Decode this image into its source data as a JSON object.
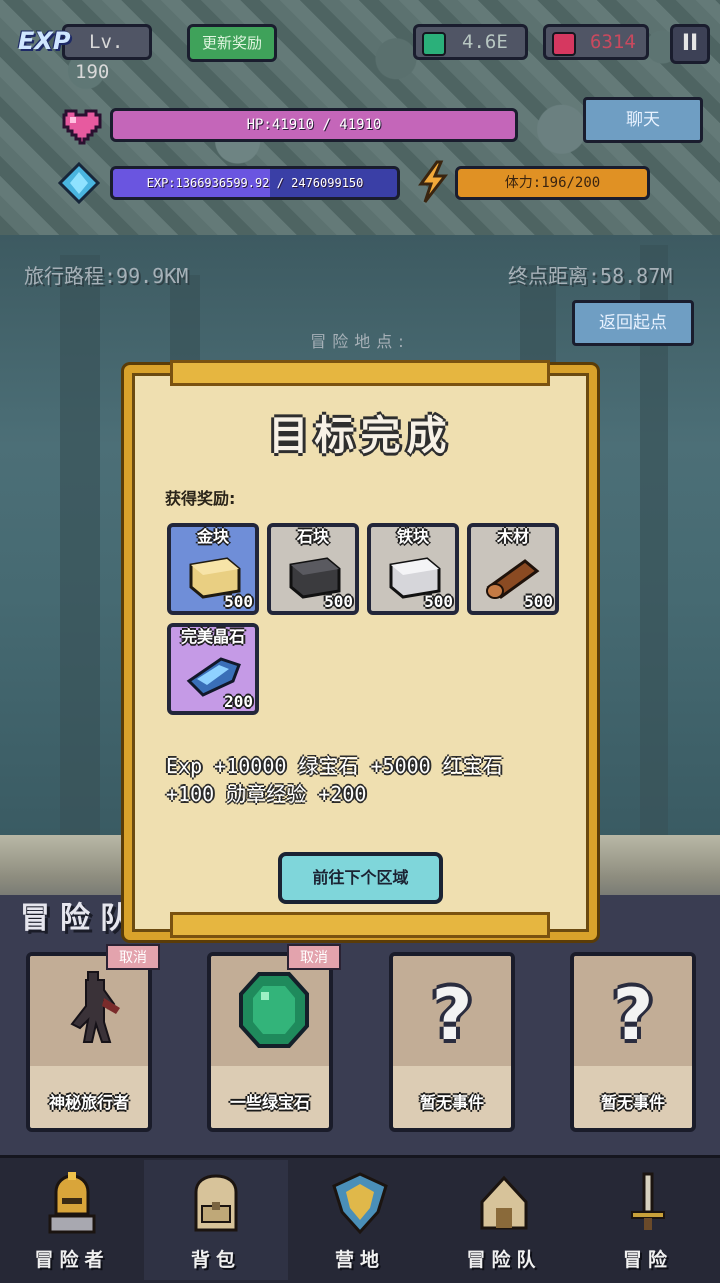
{
  "hud": {
    "exp_badge": "EXP",
    "level": "Lv. 190",
    "update_reward_label": "更新奖励",
    "emerald_count": "4.6E",
    "ruby_count": "6314",
    "pause_label": "II",
    "hp_text": "HP:41910 / 41910",
    "exp_text": "EXP:1366936599.92 / 2476099150",
    "exp_progress": 0.552,
    "stamina_text": "体力:196/200",
    "stamina_progress": 0.98,
    "chat_label": "聊天"
  },
  "journey": {
    "travel_distance": "旅行路程:99.9KM",
    "end_distance": "终点距离:58.87M",
    "return_label": "返回起点",
    "location_label": "冒险地点:"
  },
  "modal": {
    "title": "目标完成",
    "rewards_heading": "获得奖励:",
    "items": [
      {
        "name": "金块",
        "qty": "500",
        "icon": "gold-block-icon"
      },
      {
        "name": "石块",
        "qty": "500",
        "icon": "stone-block-icon"
      },
      {
        "name": "铁块",
        "qty": "500",
        "icon": "iron-block-icon"
      },
      {
        "name": "木材",
        "qty": "500",
        "icon": "wood-log-icon"
      },
      {
        "name": "完美晶石",
        "qty": "200",
        "icon": "perfect-crystal-icon"
      }
    ],
    "reward_summary": "Exp +10000  绿宝石 +5000  红宝石 +100  勋章经验 +200",
    "next_button_label": "前往下个区域"
  },
  "team": {
    "title_partial": "冒险队",
    "cancel_label": "取消",
    "events": [
      {
        "label": "神秘旅行者",
        "icon": "mysterious-traveler-icon",
        "cancelable": true
      },
      {
        "label": "一些绿宝石",
        "icon": "emerald-gem-icon",
        "cancelable": true
      },
      {
        "label": "暂无事件",
        "icon": "question-mark-icon",
        "cancelable": false
      },
      {
        "label": "暂无事件",
        "icon": "question-mark-icon",
        "cancelable": false
      }
    ]
  },
  "nav": {
    "items": [
      {
        "label": "冒险者",
        "icon": "knight-helmet-icon"
      },
      {
        "label": "背包",
        "icon": "backpack-icon",
        "selected": true
      },
      {
        "label": "营地",
        "icon": "camp-banner-icon"
      },
      {
        "label": "冒险队",
        "icon": "guild-tent-icon"
      },
      {
        "label": "冒险",
        "icon": "sword-icon"
      }
    ]
  },
  "colors": {
    "hp": "#c466b9",
    "exp": "#6a55e0",
    "stamina": "#e09124",
    "modal_border": "#d9a22b",
    "modal_bg": "#efdfb0",
    "next_button": "#7fd6da"
  }
}
